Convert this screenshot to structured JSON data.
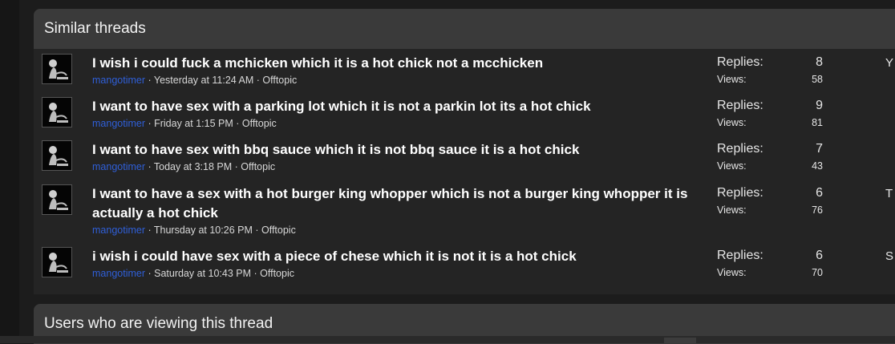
{
  "similar_threads": {
    "header": "Similar threads",
    "labels": {
      "replies": "Replies:",
      "views": "Views:"
    },
    "threads": [
      {
        "title": "I wish i could fuck a mchicken which it is a hot chick not a mcchicken",
        "author": "mangotimer",
        "meta": " · Yesterday at 11:24 AM · Offtopic",
        "replies": "8",
        "views": "58",
        "latest": "Y"
      },
      {
        "title": "I want to have sex with a parking lot which it is not a parkin lot its a hot chick",
        "author": "mangotimer",
        "meta": " · Friday at 1:15 PM · Offtopic",
        "replies": "9",
        "views": "81",
        "latest": ""
      },
      {
        "title": "I want to have sex with bbq sauce which it is not bbq sauce it is a hot chick",
        "author": "mangotimer",
        "meta": " · Today at 3:18 PM · Offtopic",
        "replies": "7",
        "views": "43",
        "latest": ""
      },
      {
        "title": "I want to have a sex with a hot burger king whopper which is not a burger king whopper it is actually a hot chick",
        "author": "mangotimer",
        "meta": " · Thursday at 10:26 PM · Offtopic",
        "replies": "6",
        "views": "76",
        "latest": "T"
      },
      {
        "title": "i wish i could have sex with a piece of chese which it is not it is a hot chick",
        "author": "mangotimer",
        "meta": " · Saturday at 10:43 PM · Offtopic",
        "replies": "6",
        "views": "70",
        "latest": "S"
      }
    ]
  },
  "users_viewing": {
    "header": "Users who are viewing this thread"
  }
}
